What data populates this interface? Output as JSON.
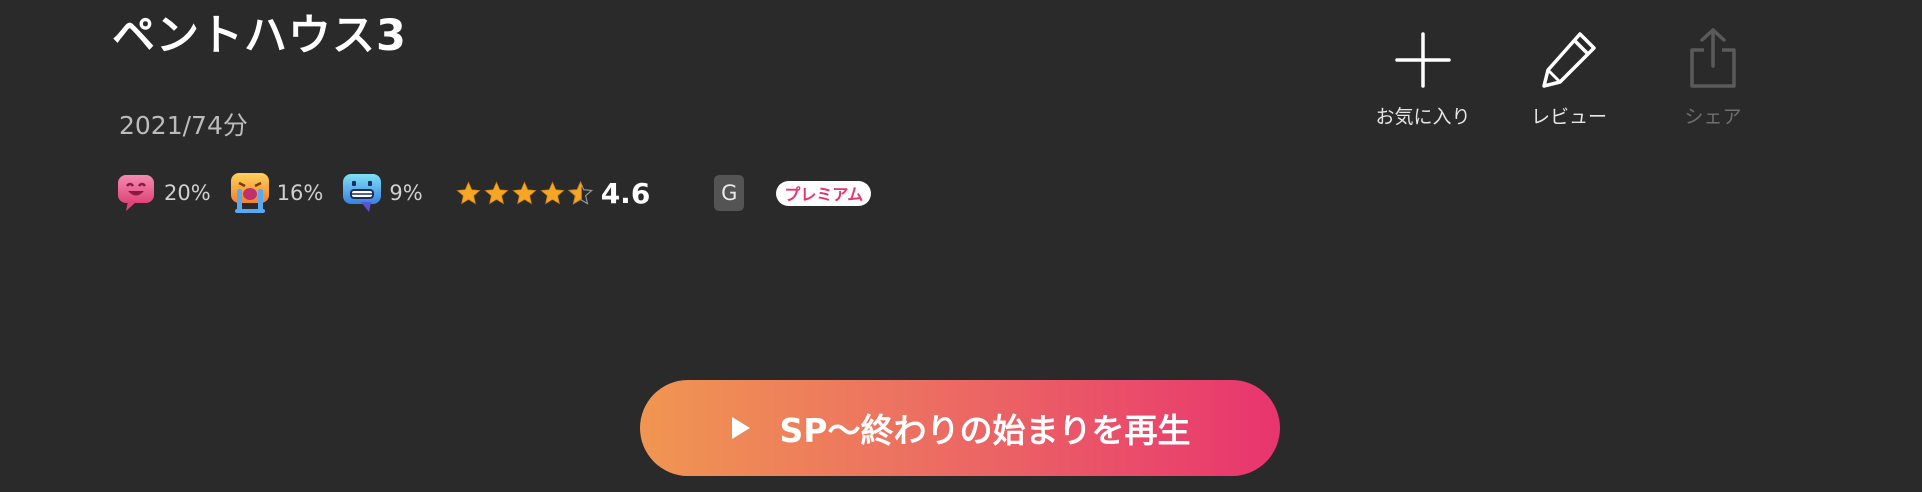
{
  "title": "ペントハウス3",
  "meta": "2021/74分",
  "reactions": [
    {
      "icon": "smile-face-icon",
      "percent": "20%"
    },
    {
      "icon": "crying-face-icon",
      "percent": "16%"
    },
    {
      "icon": "grimace-face-icon",
      "percent": "9%"
    }
  ],
  "rating": {
    "value": "4.6",
    "stars": 4.6,
    "star_color": "#f6a623"
  },
  "age_rating": "G",
  "badge": "プレミアム",
  "actions": {
    "favorite": {
      "label": "お気に入り",
      "icon": "plus-icon"
    },
    "review": {
      "label": "レビュー",
      "icon": "pencil-icon"
    },
    "share": {
      "label": "シェア",
      "icon": "share-icon",
      "state": "disabled"
    }
  },
  "play_button": {
    "label": "SP〜終わりの始まりを再生",
    "icon": "play-icon"
  },
  "colors": {
    "background": "#2a2a2a",
    "play_gradient_start": "#f09651",
    "play_gradient_end": "#e8346f",
    "premium_text": "#e7336f"
  }
}
